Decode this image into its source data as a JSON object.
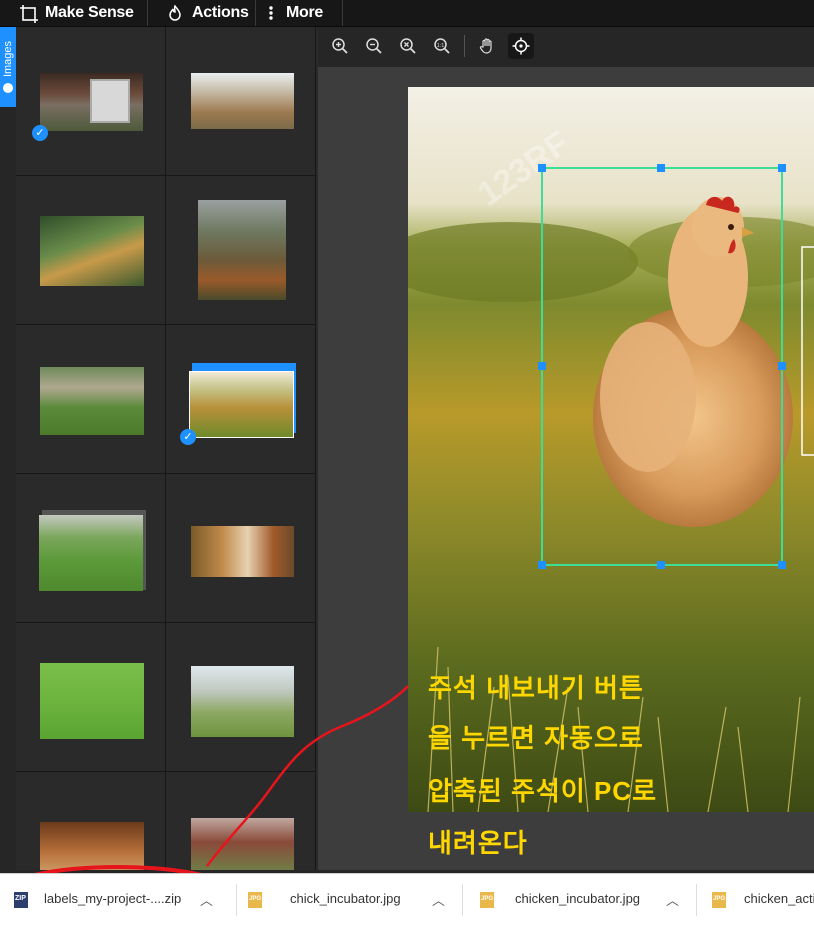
{
  "topbar": {
    "app_name": "Make Sense",
    "actions_label": "Actions",
    "more_label": "More"
  },
  "sidebar": {
    "tab_label": "Images"
  },
  "downloads": {
    "items": [
      {
        "name": "labels_my-project-....zip",
        "icon": "zip-file-icon"
      },
      {
        "name": "chick_incubator.jpg",
        "icon": "jpg-file-icon"
      },
      {
        "name": "chicken_incubator.jpg",
        "icon": "jpg-file-icon"
      },
      {
        "name": "chicken_acti",
        "icon": "jpg-file-icon"
      }
    ]
  },
  "annotation": {
    "lines": [
      "주석 내보내기 버튼",
      "을 누르면 자동으로",
      "압축된 주석이 PC로",
      "내려온다"
    ],
    "color": "#ffd700",
    "marker_color": "#e8141c"
  },
  "colors": {
    "accent": "#1e90ff",
    "bbox": "#3ddc97"
  },
  "watermark": "123RF"
}
